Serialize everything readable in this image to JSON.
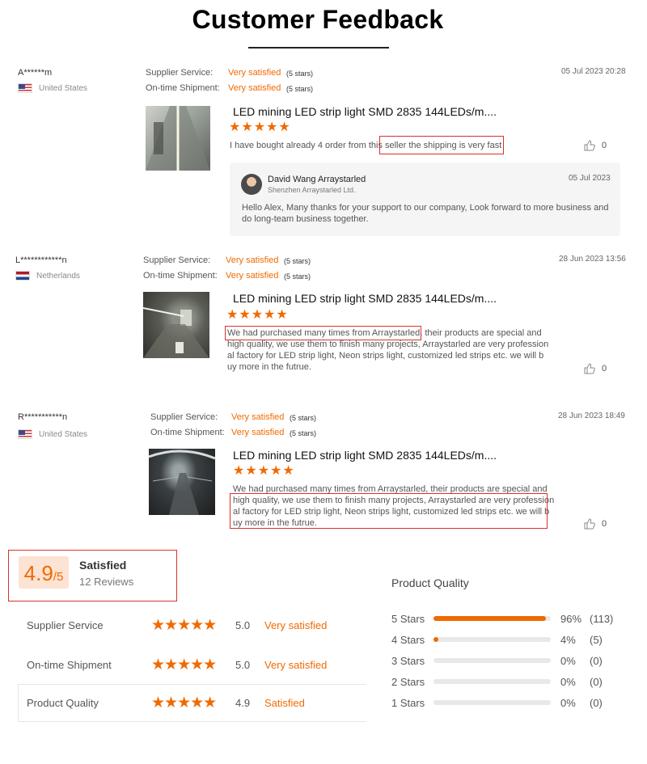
{
  "page": {
    "title": "Customer Feedback"
  },
  "meta_labels": {
    "supplier": "Supplier Service:",
    "shipment": "On-time Shipment:"
  },
  "reviews": [
    {
      "user": "A******m",
      "country": "United States",
      "flag": "us",
      "supplier_value": "Very satisfied",
      "supplier_stars": "(5 stars)",
      "shipment_value": "Very satisfied",
      "shipment_stars": "(5 stars)",
      "date": "05 Jul 2023 20:28",
      "product": "LED mining LED strip light SMD 2835 144LEDs/m....",
      "stars": "★★★★★",
      "text_lines": [
        "I have bought already 4 order from this seller the shipping is very fast"
      ],
      "likes": "0",
      "reply": {
        "name": "David Wang Arraystarled",
        "company": "Shenzhen Arraystarled Ltd.",
        "date": "05 Jul 2023",
        "text_lines": [
          "Hello Alex, Many thanks for your support to our company, Look forward to more business and",
          "do long-team business together."
        ]
      }
    },
    {
      "user": "L************n",
      "country": "Netherlands",
      "flag": "nl",
      "supplier_value": "Very satisfied",
      "supplier_stars": "(5 stars)",
      "shipment_value": "Very satisfied",
      "shipment_stars": "(5 stars)",
      "date": "28 Jun 2023 13:56",
      "product": "LED mining LED strip light SMD 2835 144LEDs/m....",
      "stars": "★★★★★",
      "text_lines": [
        "We had purchased many times from Arraystarled, their products are special and",
        "high quality, we use them to finish many projects, Arraystarled are very profession",
        "al factory for LED strip light, Neon strips light, customized led strips etc. we will b",
        "uy more in the futrue."
      ],
      "likes": "0"
    },
    {
      "user": "R***********n",
      "country": "United States",
      "flag": "us",
      "supplier_value": "Very satisfied",
      "supplier_stars": "(5 stars)",
      "shipment_value": "Very satisfied",
      "shipment_stars": "(5 stars)",
      "date": "28 Jun 2023 18:49",
      "product": "LED mining LED strip light SMD 2835 144LEDs/m....",
      "stars": "★★★★★",
      "text_lines": [
        "We had purchased many times from Arraystarled, their products are special and",
        "high quality, we use them to finish many projects, Arraystarled are very profession",
        "al factory for LED strip light, Neon strips light, customized led strips etc. we will b",
        "uy more in the futrue."
      ],
      "likes": "0"
    }
  ],
  "summary": {
    "score": "4.9",
    "score_suffix": "/5",
    "rating_word": "Satisfied",
    "review_count": "12 Reviews",
    "rows": [
      {
        "label": "Supplier Service",
        "stars": "★★★★★",
        "score": "5.0",
        "word": "Very satisfied"
      },
      {
        "label": "On-time Shipment",
        "stars": "★★★★★",
        "score": "5.0",
        "word": "Very satisfied"
      },
      {
        "label": "Product Quality",
        "stars": "★★★★★",
        "score": "4.9",
        "word": "Satisfied"
      }
    ],
    "distribution_title": "Product Quality",
    "distribution": [
      {
        "label": "5 Stars",
        "percent_label": "96%",
        "count": "(113)",
        "fraction": 0.96
      },
      {
        "label": "4 Stars",
        "percent_label": "4%",
        "count": "(5)",
        "fraction": 0.04
      },
      {
        "label": "3 Stars",
        "percent_label": "0%",
        "count": "(0)",
        "fraction": 0
      },
      {
        "label": "2 Stars",
        "percent_label": "0%",
        "count": "(0)",
        "fraction": 0
      },
      {
        "label": "1 Stars",
        "percent_label": "0%",
        "count": "(0)",
        "fraction": 0
      }
    ]
  },
  "colors": {
    "accent": "#f06a00",
    "highlight_box": "#d9312d",
    "bar_track": "#e8e8e8"
  }
}
